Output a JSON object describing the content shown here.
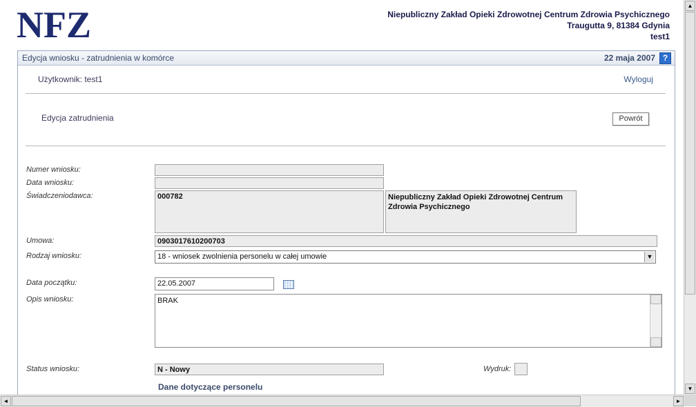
{
  "header": {
    "logo_text": "NFZ",
    "org_line1": "Niepubliczny Zakład Opieki Zdrowotnej Centrum Zdrowia Psychicznego",
    "org_line2": "Traugutta 9, 81384 Gdynia",
    "org_line3": "test1",
    "logo_color": "#1e2a6e"
  },
  "panel": {
    "title": "Edycja wniosku - zatrudnienia w komórce",
    "date": "22 maja 2007",
    "help_glyph": "?",
    "user_label": "Użytkownik: test1",
    "logout_label": "Wyloguj",
    "section_title": "Edycja zatrudnienia",
    "back_button": "Powrót"
  },
  "form": {
    "numer_label": "Numer wniosku:",
    "numer_value": "",
    "data_label": "Data wniosku:",
    "data_value": "",
    "swiadczeniodawca_label": "Świadczeniodawca:",
    "swiadczeniodawca_code": "000782",
    "swiadczeniodawca_name": "Niepubliczny Zakład Opieki Zdrowotnej Centrum Zdrowia Psychicznego",
    "umowa_label": "Umowa:",
    "umowa_value": "0903017610200703",
    "rodzaj_label": "Rodzaj wniosku:",
    "rodzaj_value": "18 - wniosek zwolnienia personelu w całej umowie",
    "data_poczatku_label": "Data początku:",
    "data_poczatku_value": "22.05.2007",
    "opis_label": "Opis wniosku:",
    "opis_value": "BRAK",
    "status_label": "Status wniosku:",
    "status_value": "N - Nowy",
    "wydruk_label": "Wydruk:",
    "dane_title": "Dane dotyczące personelu"
  },
  "scrollbars": {
    "up_arrow": "▲",
    "down_arrow": "▼",
    "left_arrow": "◄",
    "right_arrow": "►"
  }
}
